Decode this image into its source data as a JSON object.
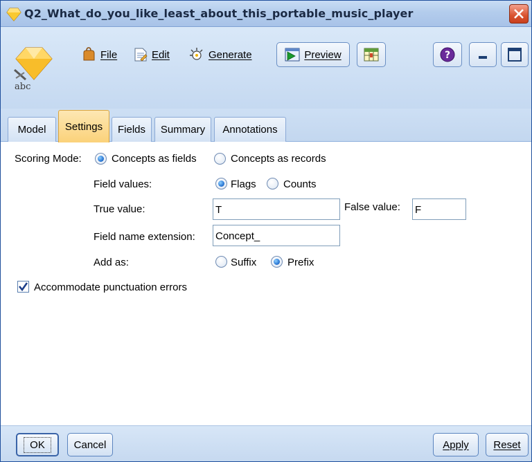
{
  "window": {
    "title": "Q2_What_do_you_like_least_about_this_portable_music_player",
    "node_icon_label": "abc"
  },
  "toolbar": {
    "file_label": "File",
    "edit_label": "Edit",
    "generate_label": "Generate",
    "preview_label": "Preview"
  },
  "tabs": [
    {
      "label": "Model",
      "active": false
    },
    {
      "label": "Settings",
      "active": true
    },
    {
      "label": "Fields",
      "active": false
    },
    {
      "label": "Summary",
      "active": false
    },
    {
      "label": "Annotations",
      "active": false
    }
  ],
  "settings": {
    "scoring_mode_label": "Scoring Mode:",
    "scoring_mode_options": [
      "Concepts as fields",
      "Concepts as records"
    ],
    "scoring_mode_selected": "Concepts as fields",
    "field_values_label": "Field values:",
    "field_values_options": [
      "Flags",
      "Counts"
    ],
    "field_values_selected": "Flags",
    "true_value_label": "True value:",
    "true_value": "T",
    "false_value_label": "False value:",
    "false_value": "F",
    "field_name_extension_label": "Field name extension:",
    "field_name_extension": "Concept_",
    "add_as_label": "Add as:",
    "add_as_options": [
      "Suffix",
      "Prefix"
    ],
    "add_as_selected": "Prefix",
    "accommodate_label": "Accommodate punctuation errors",
    "accommodate_checked": true
  },
  "footer": {
    "ok_label": "OK",
    "cancel_label": "Cancel",
    "apply_label": "Apply",
    "reset_label": "Reset"
  },
  "colors": {
    "title_bar": "#b3ccec",
    "active_tab": "#fbd27a",
    "radio_selected": "#2d7ad6",
    "close_button": "#d9532f"
  }
}
